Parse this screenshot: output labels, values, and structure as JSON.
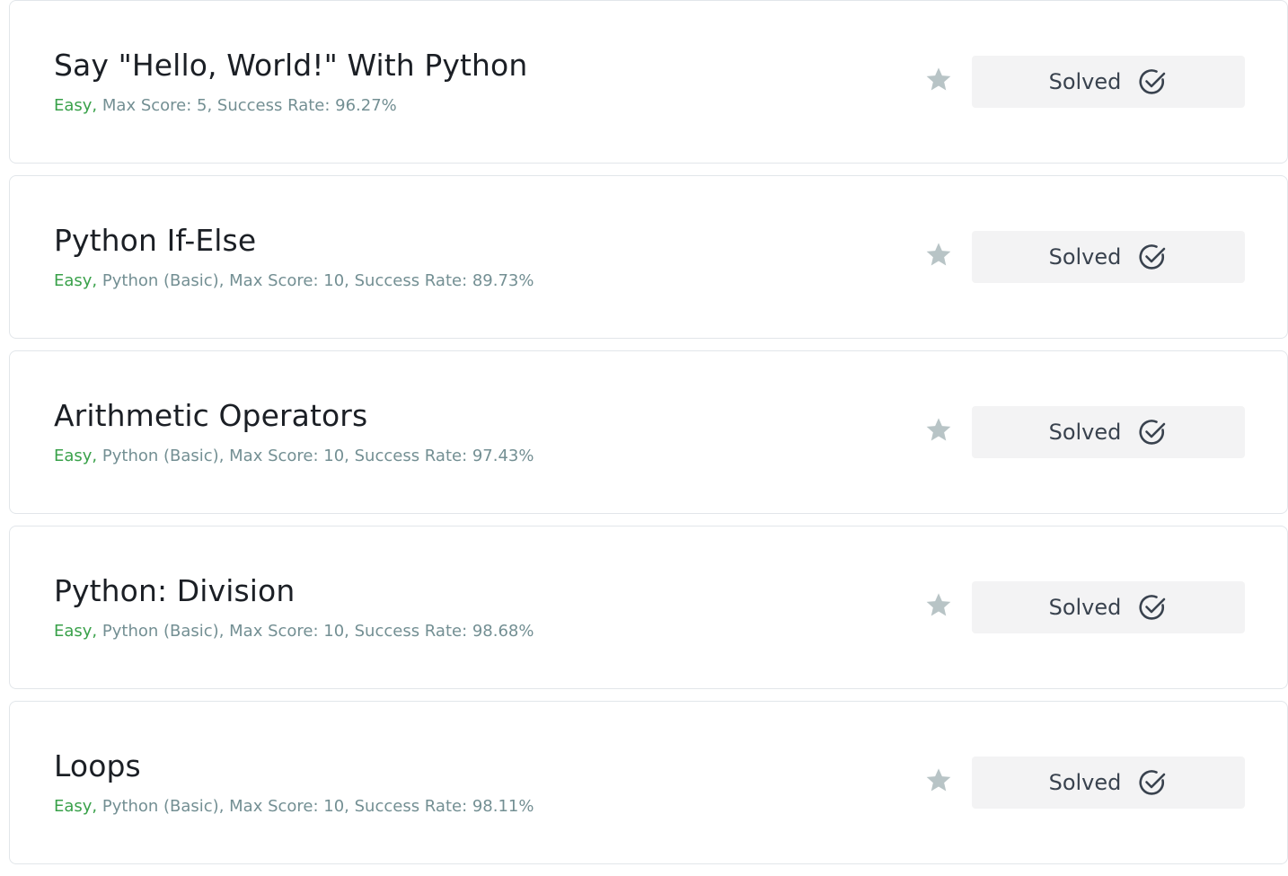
{
  "challenges": [
    {
      "title": "Say \"Hello, World!\" With Python",
      "difficulty": "Easy,",
      "details": " Max Score: 5, Success Rate: 96.27%",
      "status": "Solved"
    },
    {
      "title": "Python If-Else",
      "difficulty": "Easy,",
      "details": " Python (Basic), Max Score: 10, Success Rate: 89.73%",
      "status": "Solved"
    },
    {
      "title": "Arithmetic Operators",
      "difficulty": "Easy,",
      "details": " Python (Basic), Max Score: 10, Success Rate: 97.43%",
      "status": "Solved"
    },
    {
      "title": "Python: Division",
      "difficulty": "Easy,",
      "details": " Python (Basic), Max Score: 10, Success Rate: 98.68%",
      "status": "Solved"
    },
    {
      "title": "Loops",
      "difficulty": "Easy,",
      "details": " Python (Basic), Max Score: 10, Success Rate: 98.11%",
      "status": "Solved"
    }
  ],
  "icons": {
    "bookmark": "star-icon",
    "solved": "check-circle-icon"
  },
  "colors": {
    "difficulty_easy": "#39a14a",
    "meta_text": "#738f93",
    "star": "#b8c4c6",
    "solved_button_bg": "#f3f3f4"
  }
}
